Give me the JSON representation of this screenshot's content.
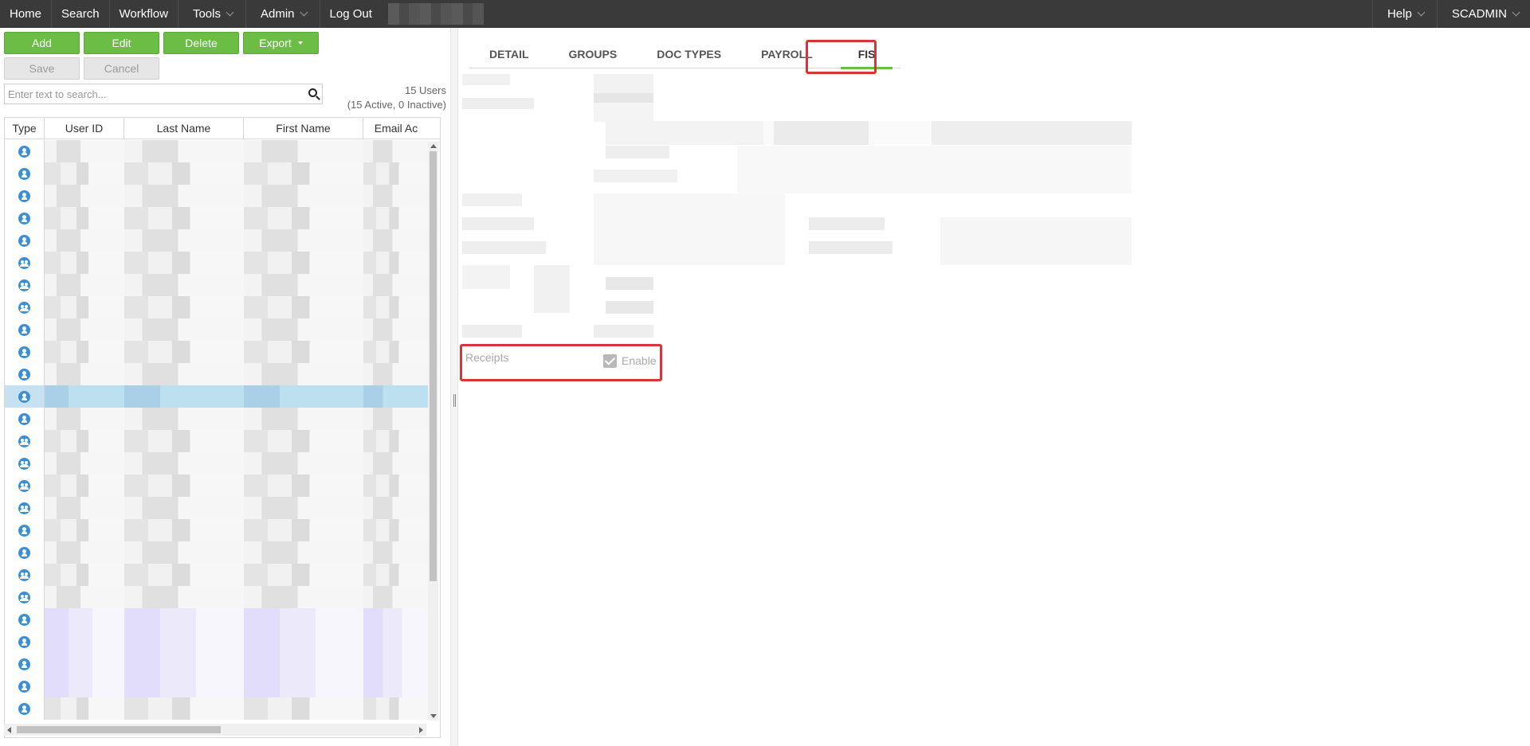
{
  "nav": {
    "home": "Home",
    "search": "Search",
    "workflow": "Workflow",
    "tools": "Tools",
    "admin": "Admin",
    "logout": "Log Out",
    "help": "Help",
    "user": "SCADMIN"
  },
  "toolbar": {
    "add": "Add",
    "edit": "Edit",
    "delete": "Delete",
    "export": "Export",
    "save": "Save",
    "cancel": "Cancel"
  },
  "search": {
    "placeholder": "Enter text to search..."
  },
  "user_count": {
    "total": "15 Users",
    "detail": "(15 Active, 0 Inactive)"
  },
  "grid": {
    "columns": [
      "Type",
      "User ID",
      "Last Name",
      "First Name",
      "Email Ac"
    ],
    "row_types": [
      "user",
      "user",
      "user",
      "user",
      "user",
      "group",
      "group",
      "group",
      "user",
      "user",
      "user",
      "user",
      "user",
      "group",
      "group",
      "group",
      "group",
      "user",
      "user",
      "group",
      "group",
      "user",
      "user",
      "user",
      "user",
      "user"
    ],
    "selected_row": 11
  },
  "tabs": [
    "DETAIL",
    "GROUPS",
    "DOC TYPES",
    "PAYROLL",
    "FIS"
  ],
  "active_tab": "FIS",
  "fis": {
    "receipts_label": "Receipts",
    "enable_label": "Enable",
    "enable_checked": true
  }
}
